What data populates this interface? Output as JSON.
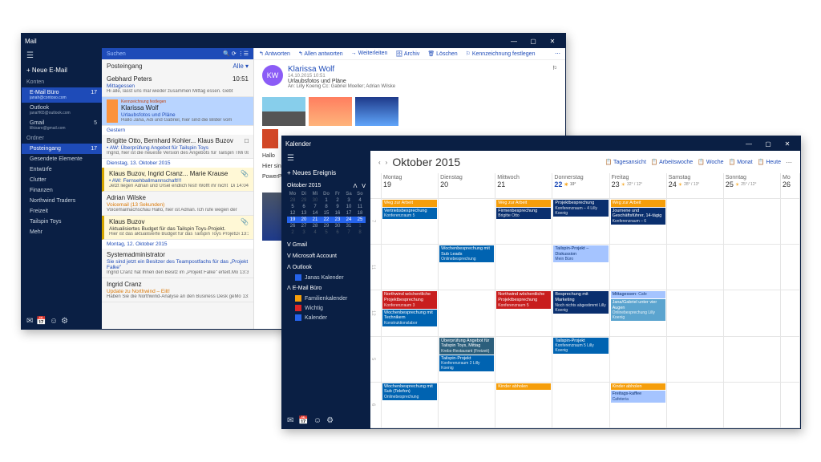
{
  "mail": {
    "title": "Mail",
    "new_email": "+ Neue E-Mail",
    "accounts_hdr": "Konten",
    "accounts": [
      {
        "name": "E-Mail Büro",
        "email": "janah@contoso.com",
        "badge": "17"
      },
      {
        "name": "Outlook",
        "email": "janaH65@outlook.com",
        "badge": ""
      },
      {
        "name": "Gmail",
        "email": "lilkisare@gmail.com",
        "badge": "5"
      }
    ],
    "folders_hdr": "Ordner",
    "folders": [
      {
        "name": "Posteingang",
        "badge": "17"
      },
      {
        "name": "Gesendete Elemente",
        "badge": ""
      },
      {
        "name": "Entwürfe",
        "badge": ""
      },
      {
        "name": "Clutter",
        "badge": ""
      },
      {
        "name": "Finanzen",
        "badge": ""
      },
      {
        "name": "Northwind Traders",
        "badge": ""
      },
      {
        "name": "Freizeit",
        "badge": ""
      },
      {
        "name": "Tailspin Toys",
        "badge": ""
      },
      {
        "name": "Mehr",
        "badge": ""
      }
    ],
    "search": "Suchen",
    "inbox_title": "Posteingang",
    "all": "Alle ▾",
    "flag_label": "Kennzeichnung festlegen",
    "groups": {
      "g0": "Gestern",
      "g1": "Dienstag, 13. Oktober 2015",
      "g2": "Montag, 12. Oktober 2015"
    },
    "messages": [
      {
        "from": "Gebhard Peters",
        "subject": "Mittagessen",
        "preview": "Hi alle, lasst uns mal wieder zusammen Mittag essen. Gebt",
        "time": "10:51"
      },
      {
        "from": "Klarissa Wolf",
        "subject": "Urlaubsfotos und Pläne",
        "preview": "Hallo Jana, Adi und Gabriel, hier sind die Bilder vom",
        "time": ""
      },
      {
        "from": "Brigitte Otto, Bernhard Kohler... Klaus Buzov",
        "subject": "• AW: Überprüfung Angebot für Tailspin Toys",
        "preview": "Ingrid, hier ist die neueste Version des Angebots für Tailspin T",
        "time": "Mi 08:29",
        "icon": "□"
      },
      {
        "from": "Klaus Buzov, Ingrid Cranz... Marie Krause",
        "subject": "• AW: Fernsehballmannschaft!!!",
        "preview": "Jetzt liegen Adrian und Ursel endlich fest! Wofft ihr nicht",
        "time": "Di 14:04",
        "icon": "📎"
      },
      {
        "from": "Adrian Wilske",
        "subject": "Voicemail (13 Sekunden)",
        "preview": "Voicemailnachschau Hallo, hier ist Adrian. Ich rufe wegen der",
        "time": ""
      },
      {
        "from": "Klaus Buzov",
        "subject": "Aktualisiertes Budget für das Tailspin Toys-Projekt.",
        "preview": "Hier ist das aktualisierte Budget für das Tailspin Toys Projet",
        "time": "Di 13:33",
        "icon": "📎"
      },
      {
        "from": "Systemadministrator",
        "subject": "Sie sind jetzt ein Besitzer des Teampostfachs für das „Projekt Falke\"",
        "preview": "Ingrid Cranz hat Ihnen den Besitz im „Projekt Falke\" erteilt.",
        "time": "Mo 13:32"
      },
      {
        "from": "Ingrid Cranz",
        "subject": "Update zu Northwind – Eilt!",
        "preview": "Haben Sie die Northwind-Analyse an den Business Desk ge",
        "time": "Mo 13:29"
      }
    ],
    "toolbar": {
      "reply": "↰ Antworten",
      "replyall": "↰ Allen antworten",
      "forward": "→ Weiterleiten",
      "archive": "🗄 Archiv",
      "delete": "🗑 Löschen",
      "flag": "⚐ Kennzeichnung festlegen"
    },
    "read": {
      "avatar": "KW",
      "from": "Klarissa Wolf",
      "date": "14.10.2015 10:51",
      "subject": "Urlaubsfotos und Pläne",
      "to": "An: Lilly Koenig  Cc: Gabriel Moeller; Adrian Wilske",
      "greeting": "Hallo",
      "p1": "Hier sind die Fotos vom letzten Wochenende",
      "label": "PowerPoint"
    }
  },
  "cal": {
    "title": "Kalender",
    "new_event": "+ Neues Ereignis",
    "mini_month": "Oktober 2015",
    "dow": [
      "Mo",
      "Di",
      "Mi",
      "Do",
      "Fr",
      "Sa",
      "So"
    ],
    "mini_weeks": [
      [
        "28",
        "29",
        "30",
        "1",
        "2",
        "3",
        "4"
      ],
      [
        "5",
        "6",
        "7",
        "8",
        "9",
        "10",
        "11"
      ],
      [
        "12",
        "13",
        "14",
        "15",
        "16",
        "17",
        "18"
      ],
      [
        "19",
        "20",
        "21",
        "22",
        "23",
        "24",
        "25"
      ],
      [
        "26",
        "27",
        "28",
        "29",
        "30",
        "31",
        "1"
      ],
      [
        "2",
        "3",
        "4",
        "5",
        "6",
        "7",
        "8"
      ]
    ],
    "sections": [
      {
        "name": "Gmail",
        "items": []
      },
      {
        "name": "Microsoft Account",
        "items": []
      },
      {
        "name": "Outlook",
        "items": [
          {
            "name": "Janas Kalender",
            "class": "on"
          }
        ]
      },
      {
        "name": "E-Mail Büro",
        "items": [
          {
            "name": "Familienkalender",
            "class": ""
          },
          {
            "name": "Wichtig",
            "class": "red"
          },
          {
            "name": "Kalender",
            "class": "on"
          }
        ]
      }
    ],
    "month": "Oktober 2015",
    "views": {
      "day": "📋 Tagesansicht",
      "work": "📋 Arbeitswoche",
      "week": "📋 Woche",
      "month": "📋 Monat",
      "today": "📋 Heute"
    },
    "days": [
      {
        "name": "Montag",
        "date": "19"
      },
      {
        "name": "Dienstag",
        "date": "20"
      },
      {
        "name": "Mittwoch",
        "date": "21"
      },
      {
        "name": "Donnerstag",
        "date": "22",
        "today": true,
        "wx": "☀",
        "temp": "19°"
      },
      {
        "name": "Freitag",
        "date": "23",
        "wx": "☀",
        "temp": "32° / 12°"
      },
      {
        "name": "Samstag",
        "date": "24",
        "wx": "☀",
        "temp": "28° / 13°"
      },
      {
        "name": "Sonntag",
        "date": "25",
        "wx": "☀",
        "temp": "25° / 12°"
      },
      {
        "name": "Mo",
        "date": "26"
      }
    ],
    "events": {
      "weg": "Weg zur Arbeit",
      "vertrieb": "Vertriebsbesprechung",
      "vertrieb_loc": "Konferenzraum 5",
      "firmen": "Firmenbesprechung",
      "firmen_loc": "Brigitte Otto",
      "projekt": "Projektbesprechung",
      "projekt_loc": "Konferenzraum – 4\nLilly Koenig",
      "junioren": "Journene und Geschäftsführer, 14-tägig",
      "junioren_loc": "Konferenzraum – 6",
      "wochen": "Wochenbesprechung mit Sub Leads",
      "wochen_loc": "Onlinebesprechung",
      "tailspin": "Tailspin-Projekt – Diskussion",
      "tailspin_loc": "Mein Büro",
      "northwind": "Northwind wöchentliche Projektbesprechung",
      "northwind_loc": "Konferenzraum 3",
      "northwind2_loc": "Konferenzraum 5",
      "marketing": "Besprechung mit Marketing",
      "marketing_loc": "Noch nichts abgestimmt\nLilly Koenig",
      "mittag": "Mittagessen",
      "mittag_loc": "Cafe",
      "tech": "Wochenbesprechung mit Technikern",
      "tech_loc": "Konstruktionslabor",
      "jana": "Jana/Gabriel unter vier Augen",
      "jana_loc": "Onlinebesprechung\nLilly Koenig",
      "angebot": "Überprüfung Angebot für Tailspin Toys, Mittag",
      "angebot_loc": "Krebs-Restaurant (Freizeit)",
      "ts2": "Tailspin-Projekt",
      "ts2_loc": "Konferenzraum 2\nLilly Koenig",
      "ts3_loc": "Konferenzraum 5\nLilly Koenig",
      "kinder": "Kinder abholen",
      "subtel": "Wochenbesprechung mit Sub (Telefon)",
      "subtel_loc": "Onlinebesprechung",
      "freitag": "Freitags-kaffee",
      "freitag_loc": "Cafeteria"
    }
  }
}
